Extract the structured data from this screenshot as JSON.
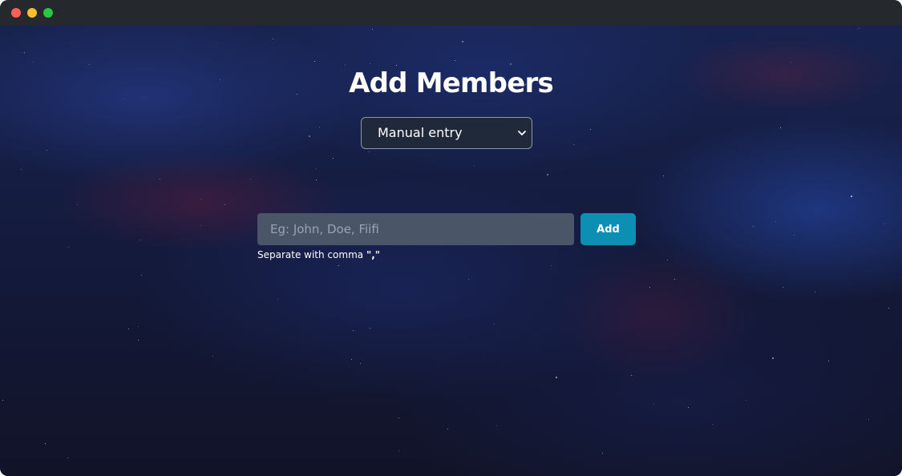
{
  "window": {
    "controls": [
      "close",
      "minimize",
      "maximize"
    ],
    "control_colors": {
      "close": "#fe5f57",
      "minimize": "#febc2e",
      "maximize": "#28c840"
    }
  },
  "page": {
    "title": "Add Members"
  },
  "entry_mode": {
    "selected": "Manual entry"
  },
  "members_input": {
    "placeholder": "Eg: John, Doe, Fiifi",
    "value": ""
  },
  "add_button": {
    "label": "Add",
    "color": "#0c8fb2"
  },
  "hint": {
    "text": "Separate with comma",
    "separator": "\",\""
  }
}
